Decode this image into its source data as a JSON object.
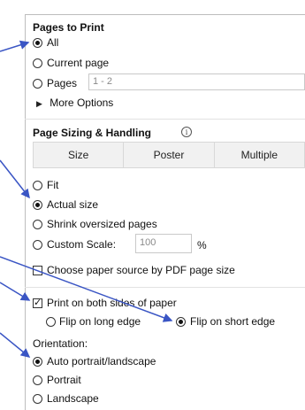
{
  "pages_to_print": {
    "title": "Pages to Print",
    "options": [
      "All",
      "Current page",
      "Pages"
    ],
    "selected": "All",
    "pages_placeholder": "1 - 2",
    "more_options": "More Options"
  },
  "page_sizing": {
    "title": "Page Sizing & Handling",
    "info_icon": "i",
    "tabs": [
      "Size",
      "Poster",
      "Multiple"
    ],
    "options": [
      "Fit",
      "Actual size",
      "Shrink oversized pages",
      "Custom Scale:"
    ],
    "selected": "Actual size",
    "scale_value": "100",
    "scale_unit": "%",
    "paper_source_label": "Choose paper source by PDF page size",
    "paper_source_checked": false
  },
  "duplex": {
    "label": "Print on both sides of paper",
    "checked": true,
    "flip_options": [
      "Flip on long edge",
      "Flip on short edge"
    ],
    "selected": "Flip on short edge"
  },
  "orientation": {
    "title": "Orientation:",
    "options": [
      "Auto portrait/landscape",
      "Portrait",
      "Landscape"
    ],
    "selected": "Auto portrait/landscape"
  },
  "colors": {
    "arrow": "#3a55c4"
  }
}
